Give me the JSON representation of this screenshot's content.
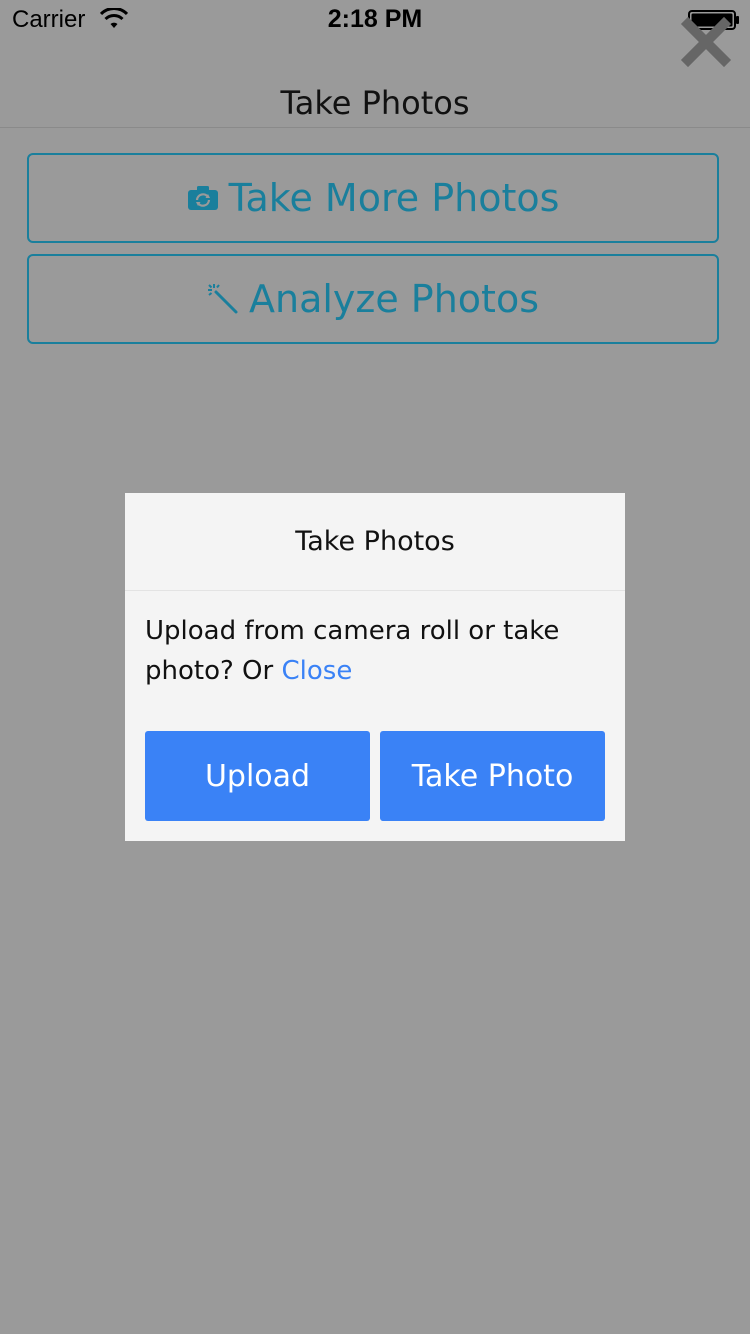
{
  "status_bar": {
    "carrier": "Carrier",
    "time": "2:18 PM",
    "wifi_icon": "wifi-icon",
    "battery_icon": "battery-icon"
  },
  "header": {
    "title": "Take Photos",
    "close_icon": "close-icon"
  },
  "actions": {
    "take_more_label": "Take More Photos",
    "take_more_icon": "camera-icon",
    "analyze_label": "Analyze Photos",
    "analyze_icon": "magic-wand-icon"
  },
  "modal": {
    "title": "Take Photos",
    "body_text": "Upload from camera roll or take photo? Or ",
    "close_link": "Close",
    "upload_label": "Upload",
    "take_photo_label": "Take Photo"
  },
  "colors": {
    "overlay_bg": "#9a9a9a",
    "accent": "#1a7f9c",
    "primary": "#3a82f6",
    "modal_bg": "#f4f4f4"
  }
}
